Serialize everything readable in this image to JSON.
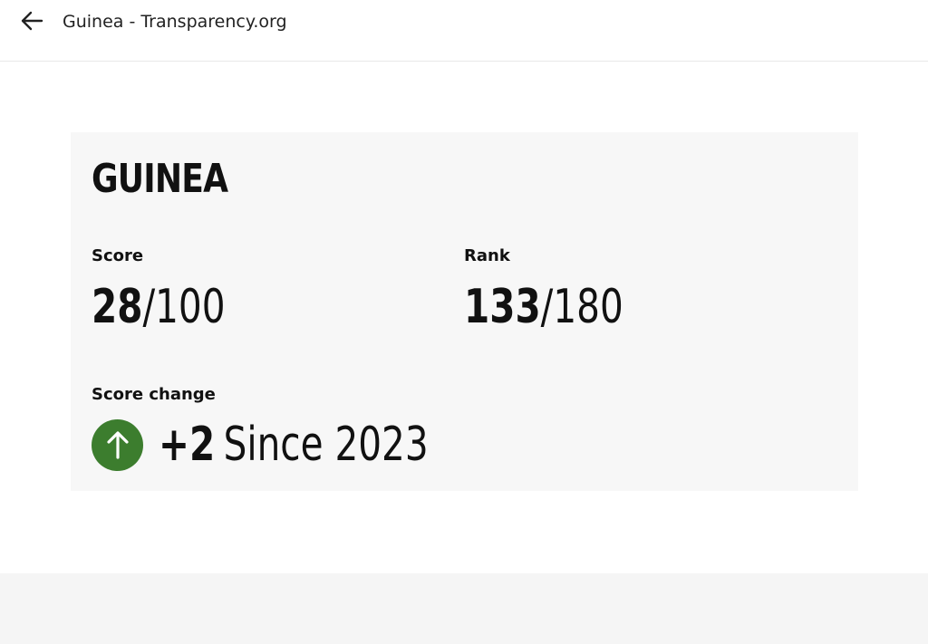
{
  "header": {
    "title": "Guinea - Transparency.org",
    "back_icon": "arrow-left-icon"
  },
  "card": {
    "country": "GUINEA",
    "score": {
      "label": "Score",
      "value": "28",
      "out_of": "/100"
    },
    "rank": {
      "label": "Rank",
      "value": "133",
      "out_of": "/180"
    },
    "score_change": {
      "label": "Score change",
      "direction_icon": "arrow-up-circle-icon",
      "delta": "+2",
      "since": "Since 2023",
      "color": "#3c7d2e"
    }
  }
}
